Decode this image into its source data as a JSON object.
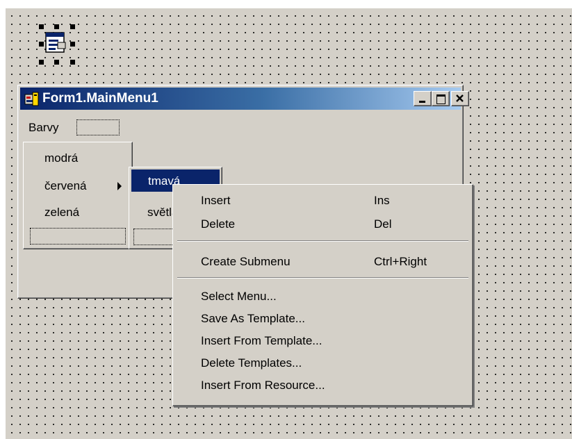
{
  "form": {
    "title": "Form1.MainMenu1",
    "menubar": {
      "item": "Barvy"
    }
  },
  "submenu1": {
    "items": [
      "modrá",
      "červená",
      "zelená"
    ]
  },
  "submenu2": {
    "items": [
      "tmavá",
      "světlá"
    ],
    "selected": "tmavá"
  },
  "context_menu": {
    "group1": [
      {
        "label": "Insert",
        "shortcut": "Ins"
      },
      {
        "label": "Delete",
        "shortcut": "Del"
      }
    ],
    "group2": [
      {
        "label": "Create Submenu",
        "shortcut": "Ctrl+Right"
      }
    ],
    "group3": [
      {
        "label": "Select Menu..."
      },
      {
        "label": "Save As Template..."
      },
      {
        "label": "Insert From Template..."
      },
      {
        "label": "Delete Templates..."
      },
      {
        "label": "Insert From Resource..."
      }
    ]
  },
  "colors": {
    "designer_bg": "#d4d0c8",
    "title_start": "#0a246a",
    "title_end": "#a6caf0",
    "highlight": "#0a246a"
  }
}
